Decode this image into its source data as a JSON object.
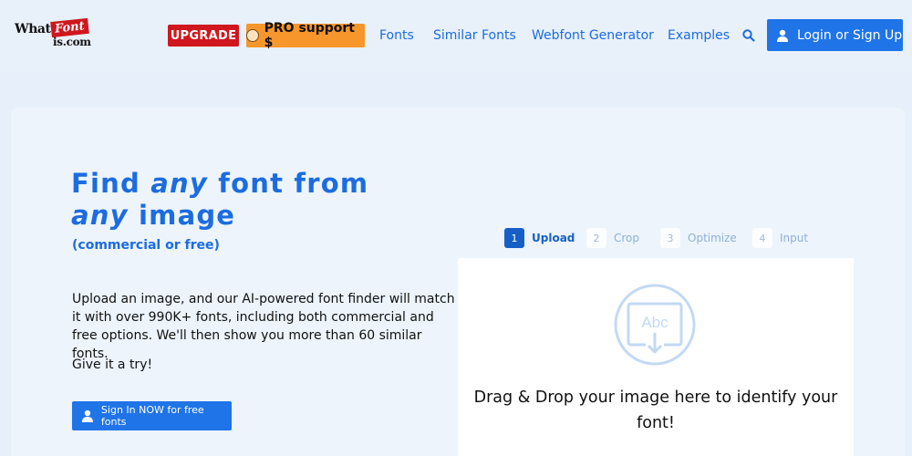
{
  "logo": {
    "what": "What",
    "font": "Font",
    "is_com": "is.com"
  },
  "header": {
    "upgrade_label": "UPGRADE",
    "pro_label": "PRO support $",
    "nav": [
      {
        "label": "Fonts"
      },
      {
        "label": "Similar Fonts"
      },
      {
        "label": "Webfont Generator"
      },
      {
        "label": "Examples"
      }
    ],
    "login_label": "Login or Sign Up"
  },
  "hero": {
    "title_parts": [
      "Find ",
      "any",
      " font from ",
      "any",
      " image"
    ],
    "subtitle": "(commercial or free)",
    "description": "Upload an image, and our AI-powered font finder will match it with over 990K+ fonts, including both commercial and free options. We'll then show you more than 60 similar fonts.",
    "cta_text": "Give it a try!",
    "signin_label": "Sign In NOW for free fonts"
  },
  "steps": [
    {
      "num": "1",
      "label": "Upload",
      "active": true
    },
    {
      "num": "2",
      "label": "Crop",
      "active": false
    },
    {
      "num": "3",
      "label": "Optimize",
      "active": false
    },
    {
      "num": "4",
      "label": "Input",
      "active": false
    }
  ],
  "upload": {
    "icon_text": "Abc",
    "drop_text": "Drag & Drop your image here to identify your font!"
  },
  "colors": {
    "accent": "#1f74e8",
    "link": "#1c6ce0",
    "upgrade": "#d0171e",
    "pro": "#f7962a",
    "background": "#e6effa"
  }
}
